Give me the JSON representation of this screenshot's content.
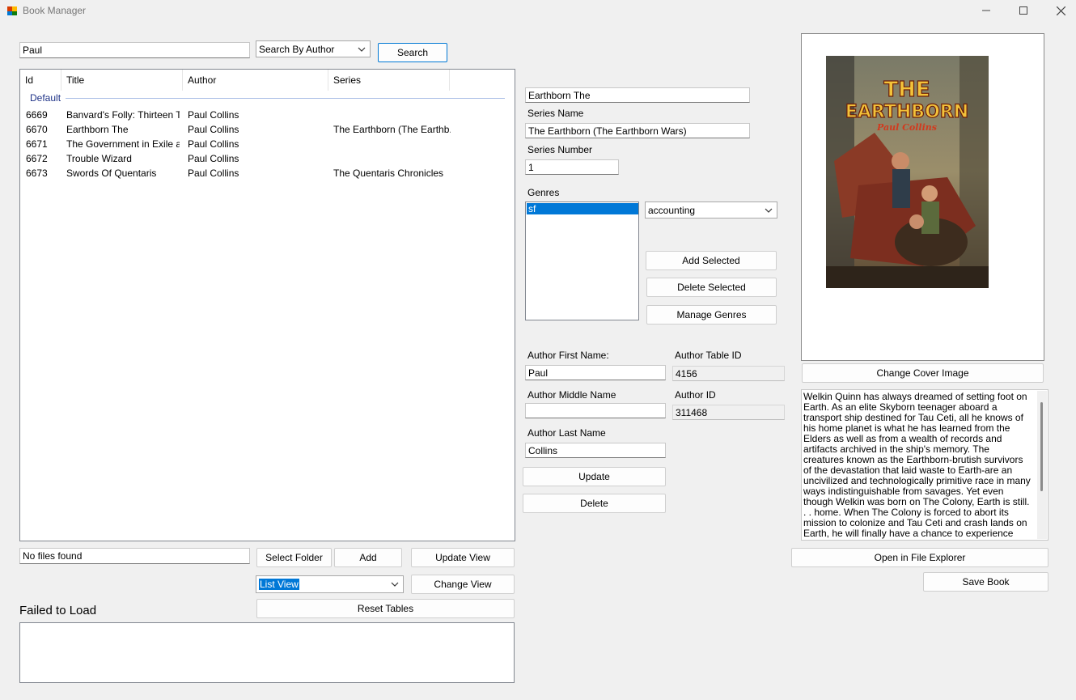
{
  "window": {
    "title": "Book Manager"
  },
  "search": {
    "query": "Paul",
    "mode": "Search By Author",
    "button": "Search"
  },
  "table": {
    "columns": [
      "Id",
      "Title",
      "Author",
      "Series"
    ],
    "group": "Default",
    "rows": [
      {
        "id": "6669",
        "title": "Banvard's Folly: Thirteen T...",
        "author": "Paul Collins",
        "series": ""
      },
      {
        "id": "6670",
        "title": "Earthborn The",
        "author": "Paul Collins",
        "series": "The Earthborn (The Earthb..."
      },
      {
        "id": "6671",
        "title": "The Government in Exile a...",
        "author": "Paul Collins",
        "series": ""
      },
      {
        "id": "6672",
        "title": "Trouble Wizard",
        "author": "Paul Collins",
        "series": ""
      },
      {
        "id": "6673",
        "title": "Swords Of Quentaris",
        "author": "Paul Collins",
        "series": "The Quentaris Chronicles"
      }
    ]
  },
  "files": {
    "status": "No files found",
    "select_folder": "Select Folder",
    "add": "Add",
    "update_view": "Update View",
    "view_mode": "List View",
    "change_view": "Change View",
    "reset_tables": "Reset Tables",
    "failed_label": "Failed to Load"
  },
  "book": {
    "title": "Earthborn The",
    "series_label": "Series Name",
    "series": "The Earthborn (The Earthborn Wars)",
    "series_number_label": "Series Number",
    "series_number": "1",
    "genres_label": "Genres",
    "genres": [
      "sf"
    ],
    "genre_select": "accounting",
    "add_selected": "Add Selected",
    "delete_selected": "Delete Selected",
    "manage_genres": "Manage Genres"
  },
  "author": {
    "first_label": "Author First Name:",
    "first": "Paul",
    "table_id_label": "Author Table ID",
    "table_id": "4156",
    "middle_label": "Author Middle Name",
    "middle": "",
    "author_id_label": "Author ID",
    "author_id": "311468",
    "last_label": "Author Last Name",
    "last": "Collins",
    "update": "Update",
    "delete": "Delete"
  },
  "cover": {
    "title_art_line1": "THE",
    "title_art_line2": "EARTHBORN",
    "author_art": "Paul Collins",
    "change_button": "Change Cover Image"
  },
  "description": "Welkin Quinn has always dreamed of setting foot on Earth. As an elite Skyborn teenager aboard a transport ship destined for Tau Ceti, all he knows of his home planet is what he has learned from the Elders as well as from a wealth of records and artifacts archived in the ship's memory. The creatures known as the Earthborn-brutish survivors of the devastation that laid waste to Earth-are an uncivilized and technologically primitive race in many ways indistinguishable from savages. Yet even though Welkin was born on The Colony, Earth is still. . . home. When The Colony is forced to abort its mission to colonize and Tau Ceti and crash lands on Earth, he will finally have a chance to experience Earth-and the Earthborn-firsthand. Assigned to a reconnaissance team to explore The Colony's",
  "actions": {
    "open_explorer": "Open in File Explorer",
    "save_book": "Save Book"
  }
}
